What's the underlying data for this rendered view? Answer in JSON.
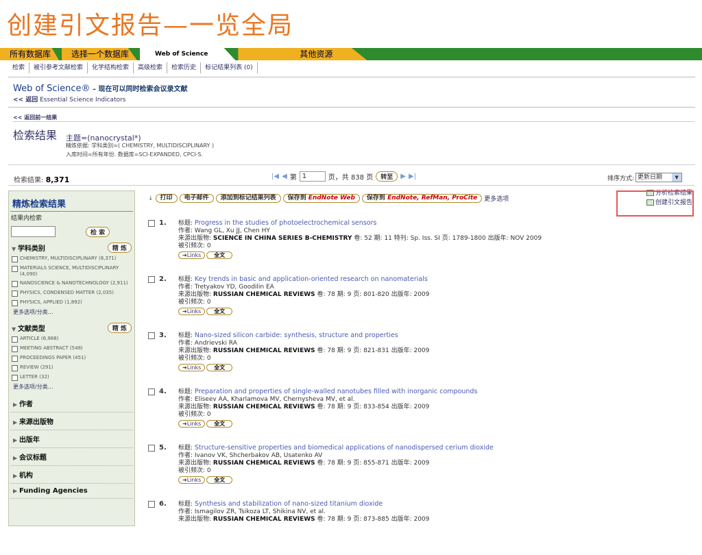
{
  "slide_title": "创建引文报告—一览全局",
  "tabs": [
    "所有数据库",
    "选择一个数据库",
    "Web of Science",
    "其他资源"
  ],
  "subnav": [
    "检索",
    "被引参考文献检索",
    "化学结构检索",
    "高级检索",
    "检索历史",
    "标记结果列表 (0)"
  ],
  "header": {
    "wos": "Web of Science®",
    "wos_sub": " – 现在可以同时检索会议录文献",
    "esi_back": "<< 返回",
    "esi": " Essential Science Indicators",
    "back_prev": "<< 返回前一结果",
    "results_title": "检索结果",
    "query": "主题=(nanocrystal*)",
    "refine": "精炼依据: 学科类别=( CHEMISTRY, MULTIDISCIPLINARY )",
    "timespan": "入库时间=所有年份. 数据库=SCI-EXPANDED, CPCI-S."
  },
  "count": {
    "label": "检索结果:",
    "value": "8,371"
  },
  "pager": {
    "pre": "第",
    "page": "1",
    "post": "页，共 838 页",
    "go": "转至"
  },
  "sort": {
    "label": "排序方式:",
    "value": "更新日期"
  },
  "sidebar": {
    "title": "精炼检索结果",
    "sub": "结果内检索",
    "search_btn": "检 索",
    "refine_btn": "精 炼",
    "sec1": "学科类别",
    "cats": [
      "CHEMISTRY, MULTIDISCIPLINARY (8,371)",
      "MATERIALS SCIENCE, MULTIDISCIPLINARY (4,090)",
      "NANOSCIENCE & NANOTECHNOLOGY (2,911)",
      "PHYSICS, CONDENSED MATTER (2,035)",
      "PHYSICS, APPLIED (1,892)"
    ],
    "more": "更多选项/分类…",
    "sec2": "文献类型",
    "types": [
      "ARTICLE (6,988)",
      "MEETING ABSTRACT (548)",
      "PROCEEDINGS PAPER (451)",
      "REVIEW (291)",
      "LETTER (32)"
    ],
    "collapsed": [
      "作者",
      "来源出版物",
      "出版年",
      "会议标题",
      "机构",
      "Funding Agencies"
    ]
  },
  "toolbar": {
    "print": "打印",
    "email": "电子邮件",
    "mark": "添加到标记结果列表",
    "save_pre": "保存到",
    "enweb": "EndNote Web",
    "enall": "EndNote, RefMan, ProCite",
    "more": "更多选项"
  },
  "right": {
    "analyze": "分析检索结果",
    "citation": "创建引文报告"
  },
  "labels": {
    "title": "标题: ",
    "author": "作者: ",
    "source": "来源出版物: ",
    "cited": "被引频次: ",
    "links": "➜Links",
    "fulltext": "全文"
  },
  "records": [
    {
      "n": "1.",
      "title": "Progress in the studies of photoelectrochemical sensors",
      "authors": "Wang GL, Xu JJ, Chen HY",
      "source": "SCIENCE IN CHINA SERIES B-CHEMISTRY",
      "rest": "  卷: 52  期: 11  特刊: Sp. Iss. SI  页: 1789-1800  出版年: NOV 2009",
      "cited": "0"
    },
    {
      "n": "2.",
      "title": "Key trends in basic and application-oriented research on nanomaterials",
      "authors": "Tretyakov YD, Goodilin EA",
      "source": "RUSSIAN CHEMICAL REVIEWS",
      "rest": "  卷: 78  期: 9  页: 801-820  出版年: 2009",
      "cited": "0"
    },
    {
      "n": "3.",
      "title": "Nano-sized silicon carbide: synthesis, structure and properties",
      "authors": "Andrievski RA",
      "source": "RUSSIAN CHEMICAL REVIEWS",
      "rest": "  卷: 78  期: 9  页: 821-831  出版年: 2009",
      "cited": "0"
    },
    {
      "n": "4.",
      "title": "Preparation and properties of single-walled nanotubes filled with inorganic compounds",
      "authors": "Eliseev AA, Kharlamova MV, Chernysheva MV, et al.",
      "source": "RUSSIAN CHEMICAL REVIEWS",
      "rest": "  卷: 78  期: 9  页: 833-854  出版年: 2009",
      "cited": "0"
    },
    {
      "n": "5.",
      "title": "Structure-sensitive properties and biomedical applications of nanodispersed cerium dioxide",
      "authors": "Ivanov VK, Shcherbakov AB, Usatenko AV",
      "source": "RUSSIAN CHEMICAL REVIEWS",
      "rest": "  卷: 78  期: 9  页: 855-871  出版年: 2009",
      "cited": "0"
    },
    {
      "n": "6.",
      "title": "Synthesis and stabilization of nano-sized titanium dioxide",
      "authors": "Ismagilov ZR, Tsikoza LT, Shikina NV, et al.",
      "source": "RUSSIAN CHEMICAL REVIEWS",
      "rest": "  卷: 78  期: 9  页: 873-885  出版年: 2009",
      "cited": ""
    }
  ],
  "colors": {
    "accent": "#e87722",
    "nav_green": "#2e8b2e",
    "tab_gold": "#f0b020",
    "highlight_box": "#e8545a"
  }
}
